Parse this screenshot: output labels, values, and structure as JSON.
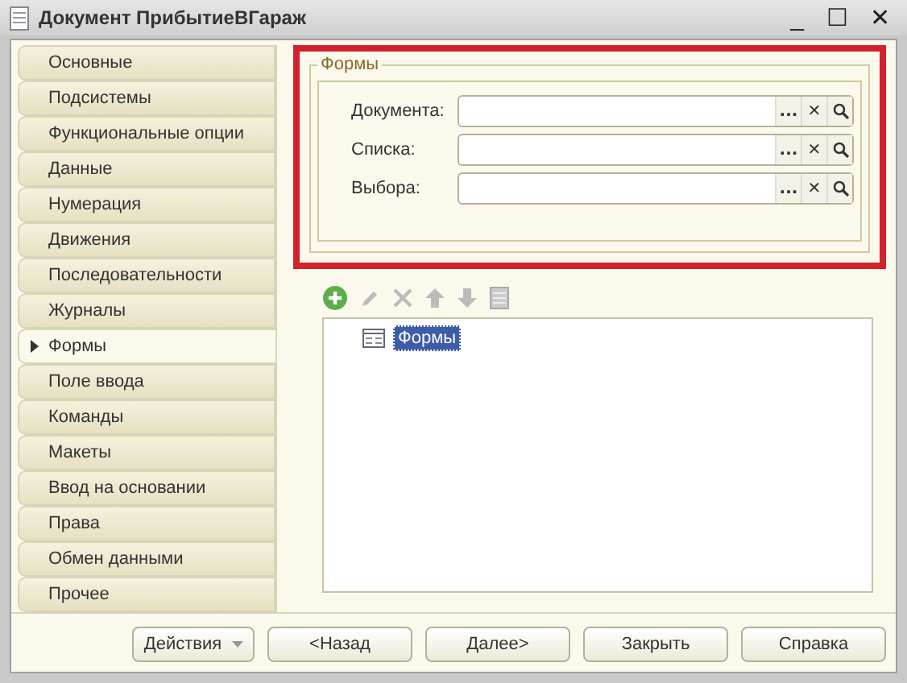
{
  "window": {
    "title": "Документ ПрибытиеВГараж",
    "controls": [
      "_",
      "☐",
      "✕"
    ]
  },
  "tabs": [
    {
      "label": "Основные",
      "selected": false
    },
    {
      "label": "Подсистемы",
      "selected": false
    },
    {
      "label": "Функциональные опции",
      "selected": false
    },
    {
      "label": "Данные",
      "selected": false
    },
    {
      "label": "Нумерация",
      "selected": false
    },
    {
      "label": "Движения",
      "selected": false
    },
    {
      "label": "Последовательности",
      "selected": false
    },
    {
      "label": "Журналы",
      "selected": false
    },
    {
      "label": "Формы",
      "selected": true
    },
    {
      "label": "Поле ввода",
      "selected": false
    },
    {
      "label": "Команды",
      "selected": false
    },
    {
      "label": "Макеты",
      "selected": false
    },
    {
      "label": "Ввод на основании",
      "selected": false
    },
    {
      "label": "Права",
      "selected": false
    },
    {
      "label": "Обмен данными",
      "selected": false
    },
    {
      "label": "Прочее",
      "selected": false
    }
  ],
  "forms_group": {
    "title": "Формы",
    "fields": [
      {
        "label": "Документа:",
        "choose": "...",
        "clear": "✕"
      },
      {
        "label": "Списка:",
        "choose": "...",
        "clear": "✕"
      },
      {
        "label": "Выбора:",
        "choose": "...",
        "clear": "✕"
      }
    ]
  },
  "tree": {
    "items": [
      {
        "label": "Формы",
        "selected": true
      }
    ]
  },
  "buttons": [
    {
      "label": "Действия",
      "kind": "dropdown"
    },
    {
      "label": "<Назад",
      "kind": "plain"
    },
    {
      "label": "Далее>",
      "kind": "plain"
    },
    {
      "label": "Закрыть",
      "kind": "plain"
    },
    {
      "label": "Справка",
      "kind": "plain"
    }
  ]
}
